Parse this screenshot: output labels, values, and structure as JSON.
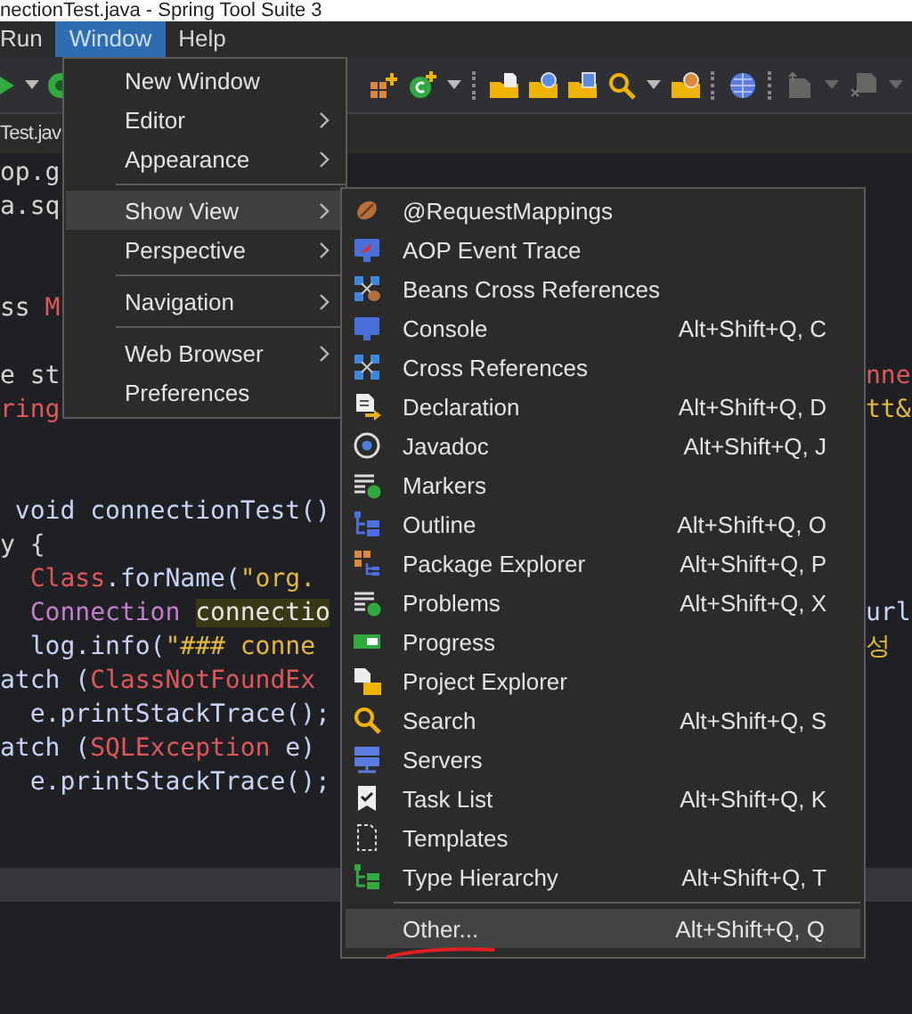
{
  "window": {
    "title": "nectionTest.java - Spring Tool Suite 3"
  },
  "menu_bar": [
    {
      "label": "Run",
      "selected": false
    },
    {
      "label": "Window",
      "selected": true
    },
    {
      "label": "Help",
      "selected": false
    }
  ],
  "editor_tab": {
    "label": "Test.jav"
  },
  "editor": {
    "lines": [
      {
        "kind": "code",
        "current": false,
        "left": [
          {
            "text": "op.g",
            "color": "#d4d4d4",
            "highlight": false
          }
        ]
      },
      {
        "kind": "code",
        "current": false,
        "left": [
          {
            "text": "a.sq",
            "color": "#d4d4d4",
            "highlight": false
          }
        ]
      },
      {
        "kind": "blank",
        "current": false
      },
      {
        "kind": "blank",
        "current": false
      },
      {
        "kind": "code",
        "current": false,
        "left": [
          {
            "text": "ss ",
            "color": "#d4d4d4",
            "highlight": false
          },
          {
            "text": "M",
            "color": "#e0575b",
            "highlight": false
          }
        ]
      },
      {
        "kind": "blank",
        "current": false
      },
      {
        "kind": "code",
        "current": false,
        "left": [
          {
            "text": "e st",
            "color": "#d4d4d4",
            "highlight": false
          }
        ],
        "right": [
          {
            "text": "nne",
            "color": "#e0575b",
            "highlight": false
          }
        ]
      },
      {
        "kind": "code",
        "current": false,
        "left": [
          {
            "text": "ring",
            "color": "#e0575b",
            "highlight": false
          }
        ],
        "right": [
          {
            "text": "tt&",
            "color": "#e5b73b",
            "highlight": false
          }
        ]
      },
      {
        "kind": "blank",
        "current": false
      },
      {
        "kind": "blank",
        "current": false
      },
      {
        "kind": "code",
        "current": false,
        "left": [
          {
            "text": " void connectionTest()",
            "color": "#c8d3f5",
            "highlight": false
          }
        ]
      },
      {
        "kind": "code",
        "current": false,
        "left": [
          {
            "text": "y {",
            "color": "#d4d4d4",
            "highlight": false
          }
        ]
      },
      {
        "kind": "code",
        "current": false,
        "left": [
          {
            "text": "  Class",
            "color": "#e0575b",
            "highlight": false
          },
          {
            "text": ".forName(",
            "color": "#c8d3f5",
            "highlight": false
          },
          {
            "text": "\"org.",
            "color": "#e5b73b",
            "highlight": false
          }
        ]
      },
      {
        "kind": "code",
        "current": false,
        "left": [
          {
            "text": "  Connection ",
            "color": "#c77dd0",
            "highlight": false
          },
          {
            "text": "connectio",
            "color": "#e6e6e6",
            "highlight": true
          }
        ],
        "right": [
          {
            "text": "url",
            "color": "#c8d3f5",
            "highlight": false
          }
        ]
      },
      {
        "kind": "code",
        "current": false,
        "left": [
          {
            "text": "  log.info(",
            "color": "#c8d3f5",
            "highlight": false
          },
          {
            "text": "\"### conne",
            "color": "#e5b73b",
            "highlight": false
          }
        ],
        "right": [
          {
            "text": "성",
            "color": "#e5b73b",
            "highlight": false
          }
        ]
      },
      {
        "kind": "code",
        "current": false,
        "left": [
          {
            "text": "atch (",
            "color": "#c8d3f5",
            "highlight": false
          },
          {
            "text": "ClassNotFoundEx",
            "color": "#e0575b",
            "highlight": false
          }
        ]
      },
      {
        "kind": "code",
        "current": false,
        "left": [
          {
            "text": "  e.printStackTrace();",
            "color": "#c8d3f5",
            "highlight": false
          }
        ]
      },
      {
        "kind": "code",
        "current": false,
        "left": [
          {
            "text": "atch (",
            "color": "#c8d3f5",
            "highlight": false
          },
          {
            "text": "SQLException",
            "color": "#e0575b",
            "highlight": false
          },
          {
            "text": " e)",
            "color": "#c8d3f5",
            "highlight": false
          }
        ]
      },
      {
        "kind": "code",
        "current": false,
        "left": [
          {
            "text": "  e.printStackTrace();",
            "color": "#c8d3f5",
            "highlight": false
          }
        ]
      },
      {
        "kind": "blank",
        "current": false
      },
      {
        "kind": "blank",
        "current": false
      },
      {
        "kind": "blank",
        "current": true
      }
    ]
  },
  "window_menu": {
    "items": [
      {
        "kind": "item",
        "label": "New Window",
        "submenu": false,
        "selected": false
      },
      {
        "kind": "item",
        "label": "Editor",
        "submenu": true,
        "selected": false
      },
      {
        "kind": "item",
        "label": "Appearance",
        "submenu": true,
        "selected": false
      },
      {
        "kind": "separator"
      },
      {
        "kind": "item",
        "label": "Show View",
        "submenu": true,
        "selected": true
      },
      {
        "kind": "item",
        "label": "Perspective",
        "submenu": true,
        "selected": false
      },
      {
        "kind": "separator"
      },
      {
        "kind": "item",
        "label": "Navigation",
        "submenu": true,
        "selected": false
      },
      {
        "kind": "separator"
      },
      {
        "kind": "item",
        "label": "Web Browser",
        "submenu": true,
        "selected": false
      },
      {
        "kind": "item",
        "label": "Preferences",
        "submenu": false,
        "selected": false
      }
    ]
  },
  "show_view_menu": {
    "items": [
      {
        "kind": "item",
        "label": "@RequestMappings",
        "selected": false
      },
      {
        "kind": "item",
        "label": "AOP Event Trace",
        "selected": false
      },
      {
        "kind": "item",
        "label": "Beans Cross References",
        "selected": false
      },
      {
        "kind": "item",
        "label": "Console",
        "shortcut": "Alt+Shift+Q, C",
        "selected": false
      },
      {
        "kind": "item",
        "label": "Cross References",
        "selected": false
      },
      {
        "kind": "item",
        "label": "Declaration",
        "shortcut": "Alt+Shift+Q, D",
        "selected": false
      },
      {
        "kind": "item",
        "label": "Javadoc",
        "shortcut": "Alt+Shift+Q, J",
        "selected": false
      },
      {
        "kind": "item",
        "label": "Markers",
        "selected": false
      },
      {
        "kind": "item",
        "label": "Outline",
        "shortcut": "Alt+Shift+Q, O",
        "selected": false
      },
      {
        "kind": "item",
        "label": "Package Explorer",
        "shortcut": "Alt+Shift+Q, P",
        "selected": false
      },
      {
        "kind": "item",
        "label": "Problems",
        "shortcut": "Alt+Shift+Q, X",
        "selected": false
      },
      {
        "kind": "item",
        "label": "Progress",
        "selected": false
      },
      {
        "kind": "item",
        "label": "Project Explorer",
        "selected": false
      },
      {
        "kind": "item",
        "label": "Search",
        "shortcut": "Alt+Shift+Q, S",
        "selected": false
      },
      {
        "kind": "item",
        "label": "Servers",
        "selected": false
      },
      {
        "kind": "item",
        "label": "Task List",
        "shortcut": "Alt+Shift+Q, K",
        "selected": false
      },
      {
        "kind": "item",
        "label": "Templates",
        "selected": false
      },
      {
        "kind": "item",
        "label": "Type Hierarchy",
        "shortcut": "Alt+Shift+Q, T",
        "selected": false
      },
      {
        "kind": "separator"
      },
      {
        "kind": "item",
        "label": "Other...",
        "shortcut": "Alt+Shift+Q, Q",
        "selected": true
      }
    ]
  }
}
